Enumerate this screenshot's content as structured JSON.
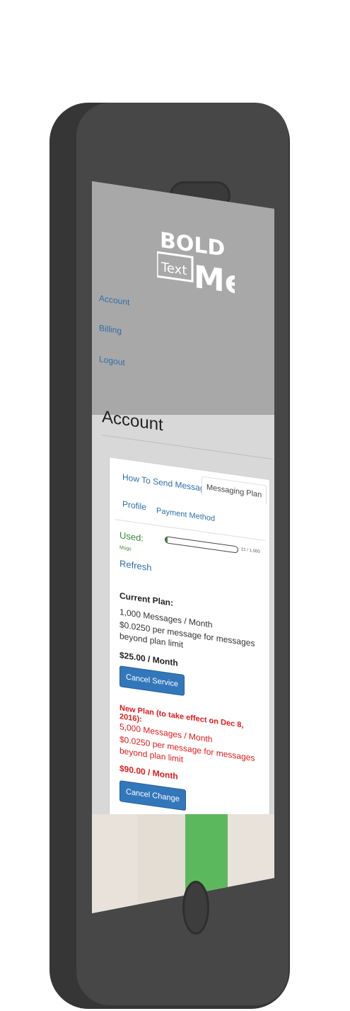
{
  "header": {
    "logo_line1": "BOLD",
    "logo_text": "Text",
    "logo_me": "Me",
    "nav": [
      "Account",
      "Billing",
      "Logout"
    ]
  },
  "page": {
    "title": "Account"
  },
  "tabs": {
    "how_to": "How To Send Messages",
    "plan": "Messaging Plan",
    "profile": "Profile",
    "payment": "Payment Method"
  },
  "usage": {
    "used_label": "Used:",
    "msgs_label": "Msgs",
    "progress_text": "21 / 1,000",
    "progress_fraction": 0.021,
    "refresh": "Refresh"
  },
  "current_plan": {
    "title": "Current Plan:",
    "messages": "1,000 Messages / Month",
    "rate": "$0.0250 per message for messages beyond plan limit",
    "price": "$25.00 / Month",
    "button": "Cancel Service"
  },
  "new_plan": {
    "title": "New Plan (to take effect on Dec 8, 2016):",
    "messages": "5,000 Messages / Month",
    "rate": "$0.0250 per message for messages beyond plan limit",
    "price": "$90.00 / Month",
    "button": "Cancel Change"
  },
  "colors": {
    "accent": "#3377bb",
    "success": "#3a8a3a",
    "warning": "#e01b1b",
    "phone": "#474747"
  }
}
